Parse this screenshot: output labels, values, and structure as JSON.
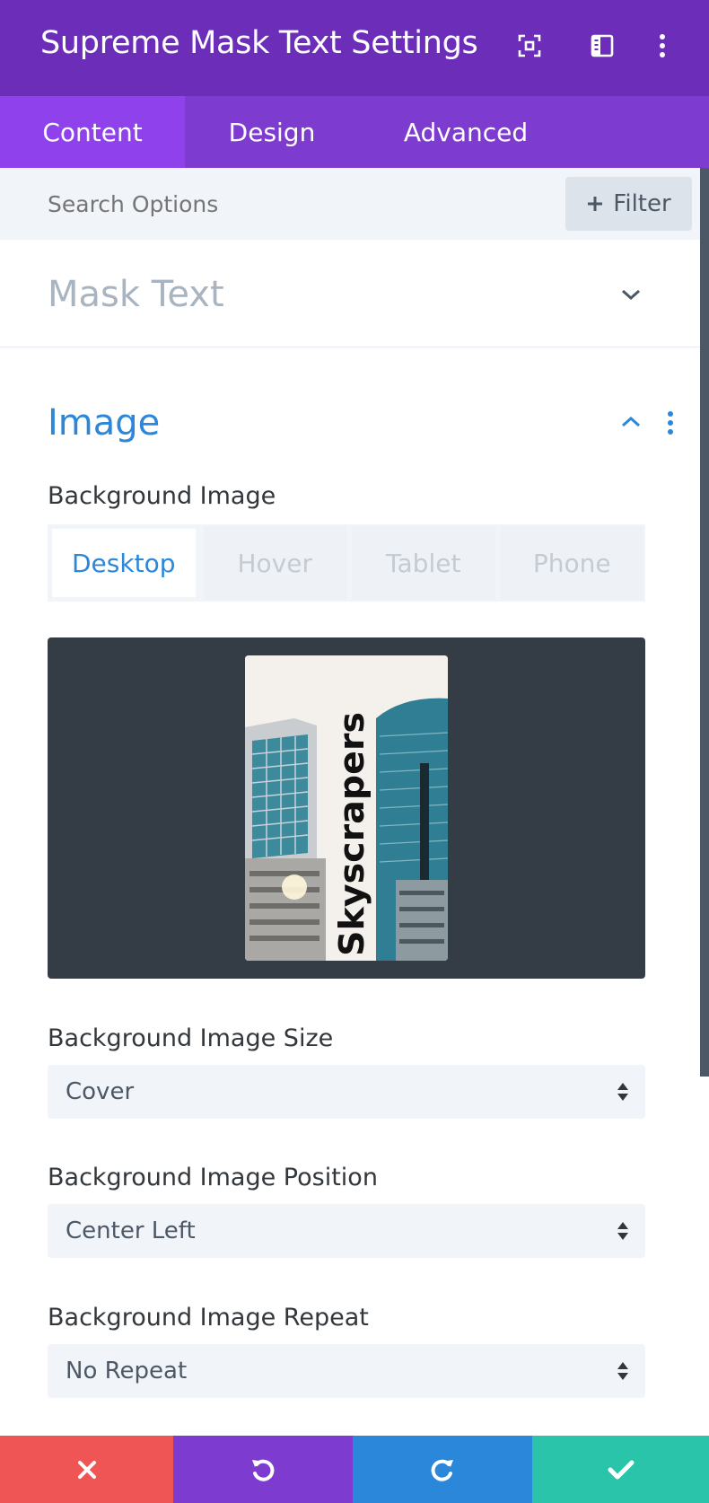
{
  "header": {
    "title": "Supreme Mask Text Settings",
    "bg_color": "#6c2eb9",
    "icons": [
      "focus-icon",
      "split-view-icon",
      "more-vertical-icon"
    ]
  },
  "tabs": [
    {
      "label": "Content",
      "active": true
    },
    {
      "label": "Design",
      "active": false
    },
    {
      "label": "Advanced",
      "active": false
    }
  ],
  "search": {
    "placeholder": "Search Options",
    "filter_label": "Filter"
  },
  "sections": {
    "mask_text": {
      "title": "Mask Text",
      "expanded": false
    },
    "image": {
      "title": "Image",
      "expanded": true
    }
  },
  "background_image": {
    "label": "Background Image",
    "device_tabs": [
      "Desktop",
      "Hover",
      "Tablet",
      "Phone"
    ],
    "active_device": "Desktop",
    "thumbnail_text": "Skyscrapers"
  },
  "fields": {
    "size": {
      "label": "Background Image Size",
      "value": "Cover"
    },
    "position": {
      "label": "Background Image Position",
      "value": "Center Left"
    },
    "repeat": {
      "label": "Background Image Repeat",
      "value": "No Repeat"
    }
  },
  "footer": {
    "colors": {
      "discard": "#ef5555",
      "undo": "#7e3bd0",
      "redo": "#2b87da",
      "save": "#29c4a9"
    },
    "icons": [
      "close-icon",
      "undo-icon",
      "redo-icon",
      "checkmark-icon"
    ]
  },
  "colors": {
    "accent": "#2b87da",
    "tab_bar": "#7e3bd0",
    "active_tab": "#8f42ec"
  }
}
